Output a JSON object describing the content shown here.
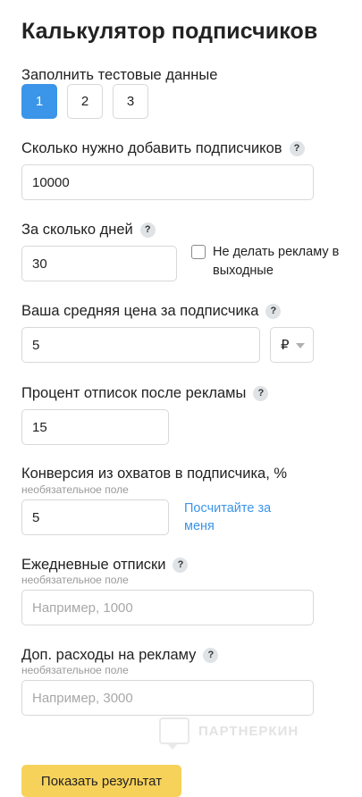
{
  "page": {
    "title": "Калькулятор подписчиков"
  },
  "test_data": {
    "label": "Заполнить тестовые данные",
    "options": [
      "1",
      "2",
      "3"
    ],
    "selected": "1"
  },
  "subscribers": {
    "label": "Сколько нужно добавить подписчиков",
    "value": "10000"
  },
  "days": {
    "label": "За сколько дней",
    "value": "30",
    "weekend_checkbox_label": "Не делать рекламу в выходные",
    "weekend_checked": false
  },
  "price": {
    "label": "Ваша средняя цена за подписчика",
    "value": "5",
    "currency": "₽"
  },
  "unsubscribe_percent": {
    "label": "Процент отписок после рекламы",
    "value": "15"
  },
  "conversion": {
    "label": "Конверсия из охватов в подписчика, %",
    "optional_note": "необязательное поле",
    "value": "5",
    "calc_link": "Посчитайте за меня"
  },
  "daily_unsubscribes": {
    "label": "Ежедневные отписки",
    "optional_note": "необязательное поле",
    "placeholder": "Например, 1000"
  },
  "extra_costs": {
    "label": "Доп. расходы на рекламу",
    "optional_note": "необязательное поле",
    "placeholder": "Например, 3000"
  },
  "watermark": {
    "text": "ПАРТНЕРКИН"
  },
  "actions": {
    "submit_label": "Показать результат"
  },
  "icons": {
    "help": "question-mark-icon",
    "dropdown": "chevron-down-icon",
    "help_glyph": "?"
  },
  "colors": {
    "accent": "#3b95e8",
    "submit_bg": "#f7d25a",
    "help_bg": "#dfe3e6"
  }
}
